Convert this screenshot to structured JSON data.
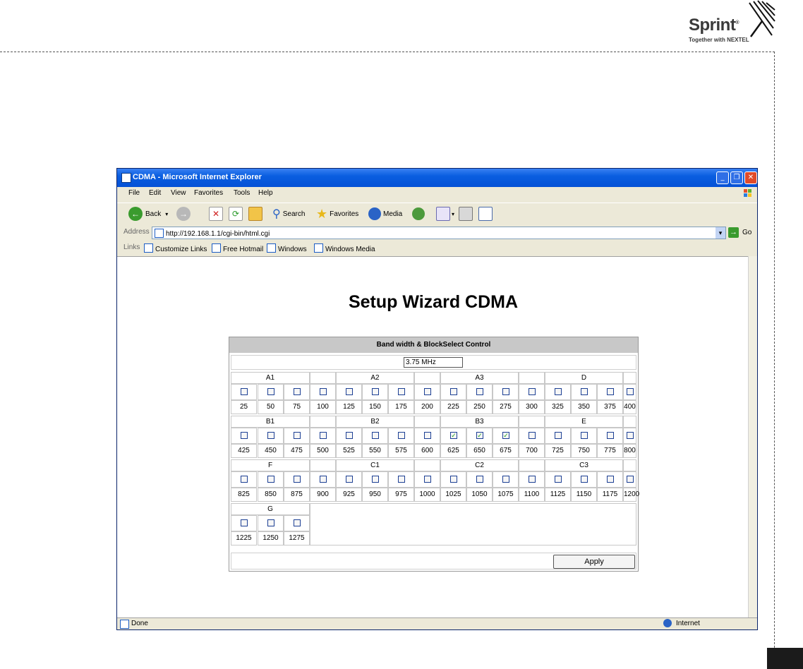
{
  "brand": {
    "name": "Sprint",
    "tagline": "Together with NEXTEL"
  },
  "window": {
    "title": "CDMA - Microsoft Internet Explorer",
    "menu": [
      "File",
      "Edit",
      "View",
      "Favorites",
      "Tools",
      "Help"
    ],
    "toolbar": {
      "back": "Back",
      "search": "Search",
      "favorites": "Favorites",
      "media": "Media"
    },
    "address_label": "Address",
    "address": "http://192.168.1.1/cgi-bin/html.cgi",
    "go": "Go",
    "links_label": "Links",
    "links": [
      "Customize Links",
      "Free Hotmail",
      "Windows",
      "Windows Media"
    ],
    "status": "Done",
    "zone": "Internet"
  },
  "page": {
    "title": "Setup Wizard CDMA",
    "panel_title": "Band width & BlockSelect Control",
    "bandwidth": "3.75 MHz",
    "apply": "Apply",
    "rows": [
      {
        "groups": [
          {
            "label": "A1",
            "span": 3
          },
          {
            "label": "",
            "span": 1
          },
          {
            "label": "A2",
            "span": 3
          },
          {
            "label": "",
            "span": 1
          },
          {
            "label": "A3",
            "span": 3
          },
          {
            "label": "",
            "span": 1
          },
          {
            "label": "D",
            "span": 3
          },
          {
            "label": "",
            "span": 1
          }
        ],
        "channels": [
          "25",
          "50",
          "75",
          "100",
          "125",
          "150",
          "175",
          "200",
          "225",
          "250",
          "275",
          "300",
          "325",
          "350",
          "375",
          "400"
        ],
        "checked": [
          false,
          false,
          false,
          false,
          false,
          false,
          false,
          false,
          false,
          false,
          false,
          false,
          false,
          false,
          false,
          false
        ]
      },
      {
        "groups": [
          {
            "label": "B1",
            "span": 3
          },
          {
            "label": "",
            "span": 1
          },
          {
            "label": "B2",
            "span": 3
          },
          {
            "label": "",
            "span": 1
          },
          {
            "label": "B3",
            "span": 3
          },
          {
            "label": "",
            "span": 1
          },
          {
            "label": "E",
            "span": 3
          },
          {
            "label": "",
            "span": 1
          }
        ],
        "channels": [
          "425",
          "450",
          "475",
          "500",
          "525",
          "550",
          "575",
          "600",
          "625",
          "650",
          "675",
          "700",
          "725",
          "750",
          "775",
          "800"
        ],
        "checked": [
          false,
          false,
          false,
          false,
          false,
          false,
          false,
          false,
          true,
          true,
          true,
          false,
          false,
          false,
          false,
          false
        ]
      },
      {
        "groups": [
          {
            "label": "F",
            "span": 3
          },
          {
            "label": "",
            "span": 1
          },
          {
            "label": "C1",
            "span": 3
          },
          {
            "label": "",
            "span": 1
          },
          {
            "label": "C2",
            "span": 3
          },
          {
            "label": "",
            "span": 1
          },
          {
            "label": "C3",
            "span": 3
          },
          {
            "label": "",
            "span": 1
          }
        ],
        "channels": [
          "825",
          "850",
          "875",
          "900",
          "925",
          "950",
          "975",
          "1000",
          "1025",
          "1050",
          "1075",
          "1100",
          "1125",
          "1150",
          "1175",
          "1200"
        ],
        "checked": [
          false,
          false,
          false,
          false,
          false,
          false,
          false,
          false,
          false,
          false,
          false,
          false,
          false,
          false,
          false,
          false
        ]
      },
      {
        "groups": [
          {
            "label": "G",
            "span": 3
          }
        ],
        "channels": [
          "1225",
          "1250",
          "1275"
        ],
        "checked": [
          false,
          false,
          false
        ]
      }
    ]
  }
}
